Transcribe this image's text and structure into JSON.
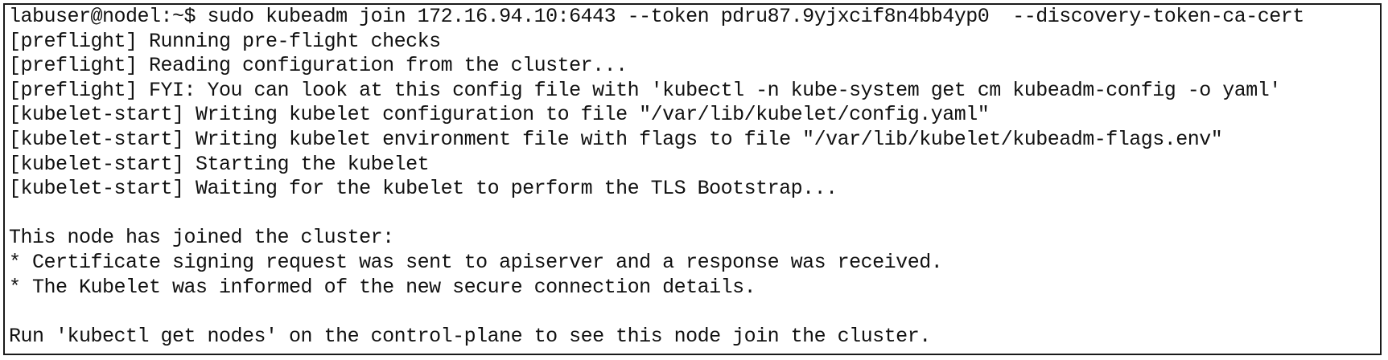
{
  "terminal": {
    "lines": [
      "labuser@nodel:~$ sudo kubeadm join 172.16.94.10:6443 --token pdru87.9yjxcif8n4bb4yp0  --discovery-token-ca-cert",
      "[preflight] Running pre-flight checks",
      "[preflight] Reading configuration from the cluster...",
      "[preflight] FYI: You can look at this config file with 'kubectl -n kube-system get cm kubeadm-config -o yaml'",
      "[kubelet-start] Writing kubelet configuration to file \"/var/lib/kubelet/config.yaml\"",
      "[kubelet-start] Writing kubelet environment file with flags to file \"/var/lib/kubelet/kubeadm-flags.env\"",
      "[kubelet-start] Starting the kubelet",
      "[kubelet-start] Waiting for the kubelet to perform the TLS Bootstrap...",
      "",
      "This node has joined the cluster:",
      "* Certificate signing request was sent to apiserver and a response was received.",
      "* The Kubelet was informed of the new secure connection details.",
      "",
      "Run 'kubectl get nodes' on the control-plane to see this node join the cluster."
    ]
  }
}
